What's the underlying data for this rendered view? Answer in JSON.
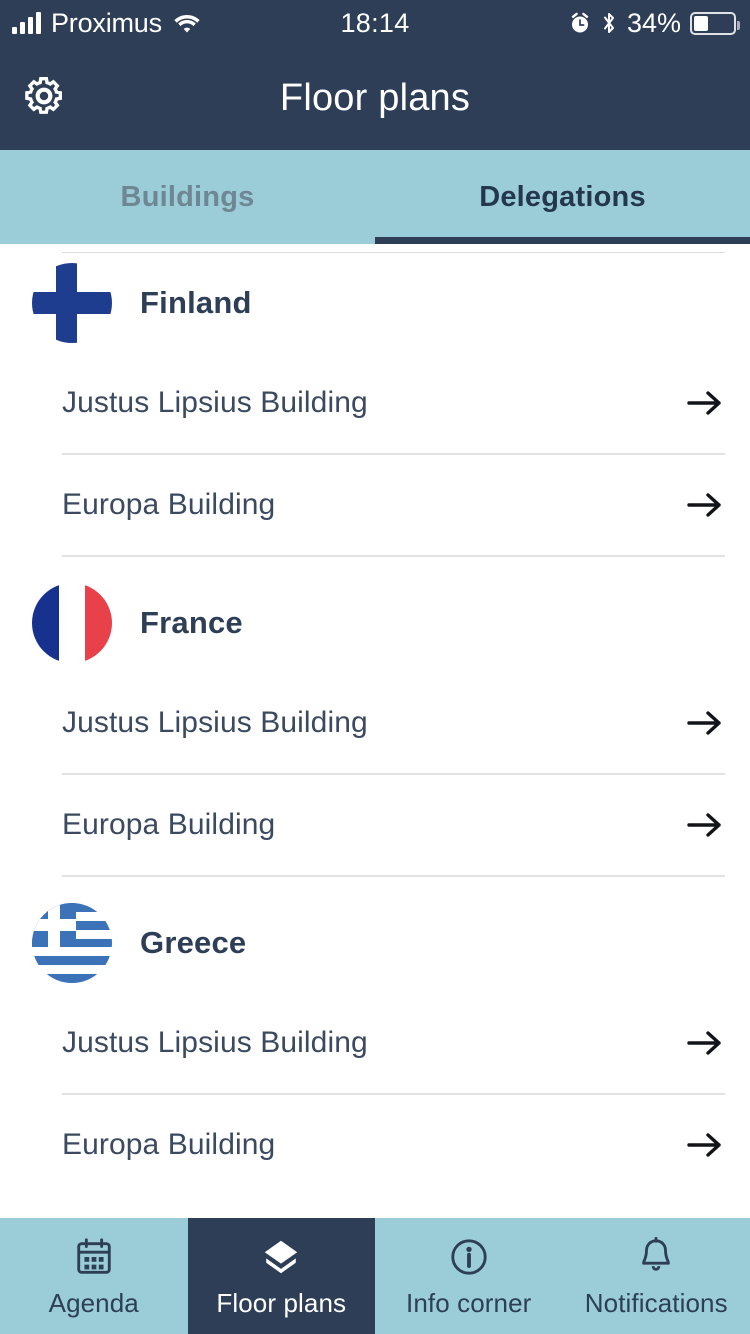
{
  "statusbar": {
    "carrier": "Proximus",
    "time": "18:14",
    "battery_percent": "34%",
    "signal_icon": "signal-bars-icon",
    "wifi_icon": "wifi-icon",
    "alarm_icon": "alarm-clock-icon",
    "bluetooth_icon": "bluetooth-icon",
    "battery_icon": "battery-icon",
    "battery_level": 34
  },
  "header": {
    "title": "Floor plans",
    "settings_icon": "gear-icon"
  },
  "tabs": [
    {
      "label": "Buildings",
      "active": false
    },
    {
      "label": "Delegations",
      "active": true
    }
  ],
  "groups": [
    {
      "name": "Finland",
      "flag": "finland-flag-icon",
      "rows": [
        {
          "label": "Justus Lipsius Building",
          "arrow": "arrow-right-icon"
        },
        {
          "label": "Europa Building",
          "arrow": "arrow-right-icon"
        }
      ]
    },
    {
      "name": "France",
      "flag": "france-flag-icon",
      "rows": [
        {
          "label": "Justus Lipsius Building",
          "arrow": "arrow-right-icon"
        },
        {
          "label": "Europa Building",
          "arrow": "arrow-right-icon"
        }
      ]
    },
    {
      "name": "Greece",
      "flag": "greece-flag-icon",
      "rows": [
        {
          "label": "Justus Lipsius Building",
          "arrow": "arrow-right-icon"
        },
        {
          "label": "Europa Building",
          "arrow": "arrow-right-icon"
        }
      ]
    }
  ],
  "bottomnav": [
    {
      "label": "Agenda",
      "icon": "calendar-icon",
      "active": false
    },
    {
      "label": "Floor plans",
      "icon": "layers-icon",
      "active": true
    },
    {
      "label": "Info corner",
      "icon": "info-circle-icon",
      "active": false
    },
    {
      "label": "Notifications",
      "icon": "bell-icon",
      "active": false
    }
  ],
  "colors": {
    "header_navy": "#2d3e56",
    "tab_teal": "#9acdd8",
    "page_background": "#ffffff",
    "row_text": "#3b4a60",
    "divider": "#e2e2e2"
  }
}
